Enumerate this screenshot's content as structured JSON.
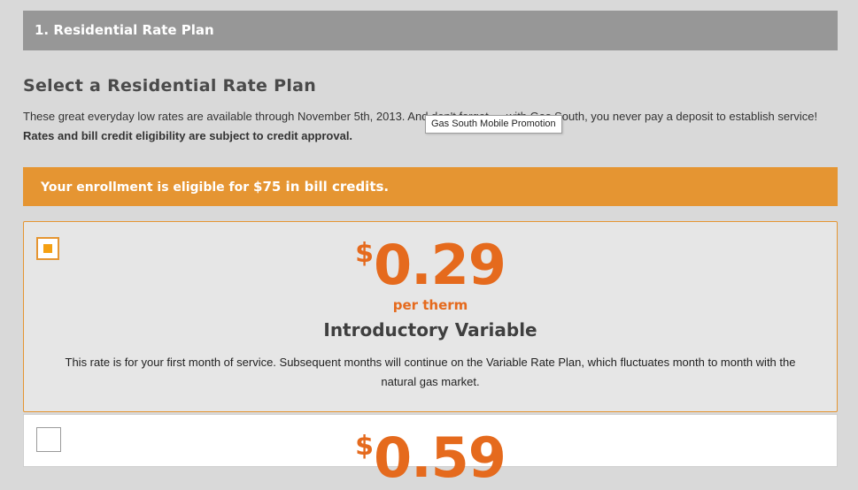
{
  "step_header": {
    "label": "1. Residential Rate Plan"
  },
  "section": {
    "title": "Select a Residential Rate Plan",
    "intro_part1": "These great everyday low rates are available through November 5th, 2013. And don't forget — with Gas South, you never pay a deposit to establish service! ",
    "intro_bold": "Rates and bill credit eligibility are subject to credit approval."
  },
  "tooltip": {
    "text": "Gas South Mobile Promotion"
  },
  "credit_banner": {
    "text": "Your enrollment is eligible for ",
    "amount": "$75 in bill credits."
  },
  "plans": [
    {
      "selected": true,
      "currency": "$",
      "price": "0.29",
      "unit": "per therm",
      "name": "Introductory Variable",
      "description": "This rate is for your first month of service. Subsequent months will continue on the Variable Rate Plan, which fluctuates month to month with the natural gas market."
    },
    {
      "selected": false,
      "currency": "$",
      "price": "0.59"
    }
  ],
  "colors": {
    "accent_orange": "#e59532",
    "price_orange": "#e56a1d",
    "header_gray": "#979797",
    "background": "#d9d9d9"
  }
}
